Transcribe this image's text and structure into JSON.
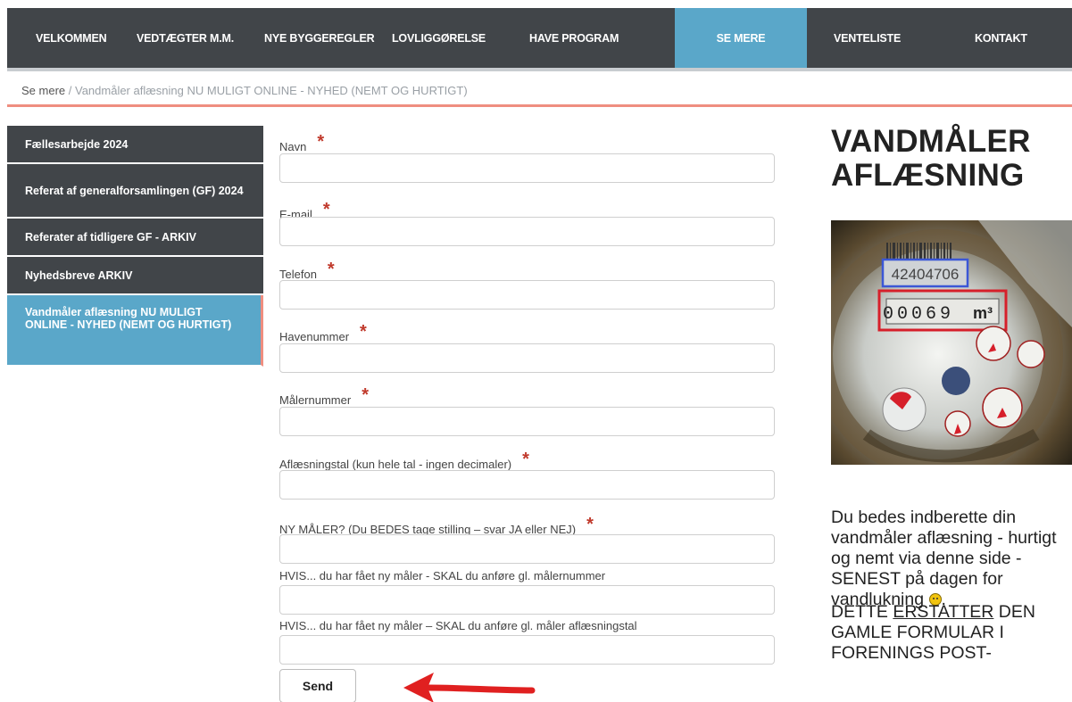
{
  "nav": {
    "items": [
      "VELKOMMEN",
      "VEDTÆGTER M.M.",
      "NYE BYGGEREGLER",
      "LOVLIGGØRELSE",
      "HAVE PROGRAM",
      "SE MERE",
      "VENTELISTE",
      "KONTAKT"
    ],
    "active": "SE MERE"
  },
  "breadcrumb": {
    "parent": "Se mere",
    "separator": " / ",
    "current": "Vandmåler aflæsning NU MULIGT ONLINE - NYHED (NEMT OG HURTIGT)"
  },
  "sidebar": {
    "items": [
      "Fællesarbejde 2024",
      "Referat af generalforsamlingen (GF) 2024",
      "Referater af tidligere GF - ARKIV",
      "Nyhedsbreve ARKIV",
      "Vandmåler aflæsning NU MULIGT ONLINE - NYHED (NEMT OG HURTIGT)"
    ]
  },
  "form": {
    "required_mark": "*",
    "fields": [
      {
        "label": "Navn",
        "required": true,
        "value": ""
      },
      {
        "label": "E-mail",
        "required": true,
        "value": ""
      },
      {
        "label": "Telefon",
        "required": true,
        "value": ""
      },
      {
        "label": "Havenummer",
        "required": true,
        "value": ""
      },
      {
        "label": "Målernummer",
        "required": true,
        "value": ""
      },
      {
        "label": "Aflæsningstal (kun hele tal - ingen decimaler)",
        "required": true,
        "value": ""
      },
      {
        "label": "NY MÅLER? (Du BEDES tage stilling – svar JA eller NEJ)",
        "required": true,
        "value": ""
      },
      {
        "label": "HVIS... du har fået ny måler - SKAL du anføre gl. målernummer",
        "required": false,
        "value": ""
      },
      {
        "label": "HVIS... du har fået ny måler – SKAL du anføre gl. måler aflæsningstal",
        "required": false,
        "value": ""
      }
    ],
    "submit_label": "Send"
  },
  "right": {
    "heading_line1": "VANDMÅLER",
    "heading_line2": "AFLÆSNING",
    "photo": {
      "serial": "42404706",
      "reading": "00069",
      "unit": "m³"
    },
    "intro": "Du bedes indberette din vandmåler aflæsning - hurtigt og nemt via denne side - SENEST på dagen for vandlukning",
    "replace_pre": "DETTE ",
    "replace_underlined": "ERSTATTER",
    "replace_post": " DEN GAMLE FORMULAR I FORENINGS POST-"
  },
  "colors": {
    "nav_bg": "#414549",
    "active_blue": "#5aa7c9",
    "accent_salmon": "#ef8e80",
    "required_red": "#c0392b",
    "arrow_red": "#e02020"
  }
}
